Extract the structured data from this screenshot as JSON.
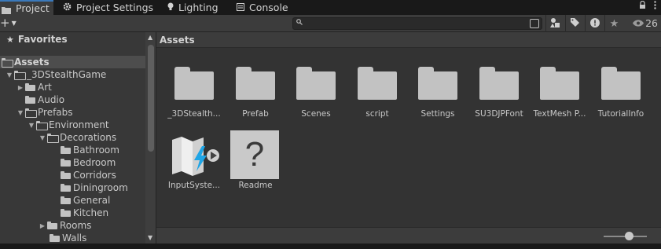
{
  "tabs": [
    {
      "label": "Project",
      "icon": "folder-icon",
      "active": true
    },
    {
      "label": "Project Settings",
      "icon": "gear-icon",
      "active": false
    },
    {
      "label": "Lighting",
      "icon": "lightbulb-icon",
      "active": false
    },
    {
      "label": "Console",
      "icon": "console-icon",
      "active": false
    }
  ],
  "toolbar": {
    "create_label": "+",
    "search_value": "",
    "search_placeholder": "",
    "hidden_count": "26"
  },
  "favorites": {
    "label": "Favorites"
  },
  "tree": [
    {
      "label": "Assets",
      "expanded": true,
      "selected": true,
      "header": true
    },
    {
      "label": "_3DStealthGame",
      "expanded": true
    },
    {
      "label": "Art",
      "expanded": false
    },
    {
      "label": "Audio"
    },
    {
      "label": "Prefabs",
      "expanded": true
    },
    {
      "label": "Environment",
      "expanded": true
    },
    {
      "label": "Decorations",
      "expanded": true
    },
    {
      "label": "Bathroom"
    },
    {
      "label": "Bedroom"
    },
    {
      "label": "Corridors"
    },
    {
      "label": "Diningroom"
    },
    {
      "label": "General"
    },
    {
      "label": "Kitchen"
    },
    {
      "label": "Rooms",
      "expanded": false
    },
    {
      "label": "Walls"
    }
  ],
  "breadcrumb": "Assets",
  "assets": [
    {
      "label": "_3DStealth...",
      "type": "folder"
    },
    {
      "label": "Prefab",
      "type": "folder"
    },
    {
      "label": "Scenes",
      "type": "folder"
    },
    {
      "label": "script",
      "type": "folder"
    },
    {
      "label": "Settings",
      "type": "folder"
    },
    {
      "label": "SU3DJPFont",
      "type": "folder"
    },
    {
      "label": "TextMesh P...",
      "type": "folder"
    },
    {
      "label": "TutorialInfo",
      "type": "folder"
    },
    {
      "label": "InputSyste...",
      "type": "input-actions"
    },
    {
      "label": "Readme",
      "type": "readme"
    }
  ],
  "colors": {
    "accent": "#3a79bb",
    "panel": "#383838",
    "grid_bg": "#333333"
  }
}
